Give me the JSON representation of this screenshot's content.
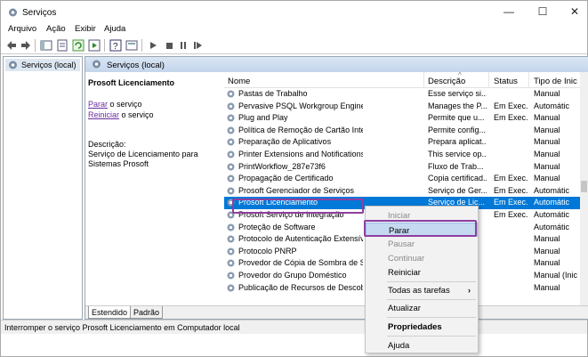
{
  "window": {
    "title": "Serviços",
    "minimize": "—",
    "maximize": "☐",
    "close": "✕"
  },
  "menu": [
    "Arquivo",
    "Ação",
    "Exibir",
    "Ajuda"
  ],
  "tree": {
    "root": "Serviços (local)"
  },
  "main": {
    "header": "Serviços (local)"
  },
  "detail": {
    "title": "Prosoft Licenciamento",
    "stop_link": "Parar",
    "stop_suffix": " o serviço",
    "restart_link": "Reiniciar",
    "restart_suffix": " o serviço",
    "desc_label": "Descrição:",
    "desc_line1": "Serviço de Licenciamento para",
    "desc_line2": "Sistemas Prosoft"
  },
  "columns": {
    "name": "Nome",
    "description": "Descrição",
    "status": "Status",
    "startup": "Tipo de Inic"
  },
  "services": [
    {
      "name": "Pastas de Trabalho",
      "desc": "Esse serviço si...",
      "status": "",
      "startup": "Manual"
    },
    {
      "name": "Pervasive PSQL Workgroup Engine",
      "desc": "Manages the P...",
      "status": "Em Exec...",
      "startup": "Automátic"
    },
    {
      "name": "Plug and Play",
      "desc": "Permite que u...",
      "status": "Em Exec...",
      "startup": "Manual"
    },
    {
      "name": "Política de Remoção de Cartão Inteligente",
      "desc": "Permite config...",
      "status": "",
      "startup": "Manual"
    },
    {
      "name": "Preparação de Aplicativos",
      "desc": "Prepara aplicat...",
      "status": "",
      "startup": "Manual"
    },
    {
      "name": "Printer Extensions and Notifications",
      "desc": "This service op...",
      "status": "",
      "startup": "Manual"
    },
    {
      "name": "PrintWorkflow_287e73f6",
      "desc": "Fluxo de Trab...",
      "status": "",
      "startup": "Manual"
    },
    {
      "name": "Propagação de Certificado",
      "desc": "Copia certificad...",
      "status": "Em Exec...",
      "startup": "Manual"
    },
    {
      "name": "Prosoft Gerenciador de Serviços",
      "desc": "Serviço de Ger...",
      "status": "Em Exec...",
      "startup": "Automátic"
    },
    {
      "name": "Prosoft Licenciamento",
      "desc": "Serviço de Lic...",
      "status": "Em Exec...",
      "startup": "Automátic"
    },
    {
      "name": "Prosoft Serviço de Integração",
      "desc": "",
      "status": "Em Exec...",
      "startup": "Automátic"
    },
    {
      "name": "Proteção de Software",
      "desc": "",
      "status": "",
      "startup": "Automátic"
    },
    {
      "name": "Protocolo de Autenticação Extensível",
      "desc": "",
      "status": "",
      "startup": "Manual"
    },
    {
      "name": "Protocolo PNRP",
      "desc": "",
      "status": "",
      "startup": "Manual"
    },
    {
      "name": "Provedor de Cópia de Sombra de Software",
      "desc": "",
      "status": "",
      "startup": "Manual"
    },
    {
      "name": "Provedor do Grupo Doméstico",
      "desc": "",
      "status": "",
      "startup": "Manual (Inic"
    },
    {
      "name": "Publicação de Recursos de Descoberta",
      "desc": "",
      "status": "",
      "startup": "Manual"
    }
  ],
  "context_menu": {
    "start": "Iniciar",
    "stop": "Parar",
    "pause": "Pausar",
    "resume": "Continuar",
    "restart": "Reiniciar",
    "all_tasks": "Todas as tarefas",
    "refresh": "Atualizar",
    "properties": "Propriedades",
    "help": "Ajuda"
  },
  "tabs": {
    "extended": "Estendido",
    "standard": "Padrão"
  },
  "status_bar": "Interromper o serviço Prosoft Licenciamento em Computador local",
  "colors": {
    "selection": "#0078d7",
    "highlight": "#8e3fa0",
    "menu_hover": "#c5d9f1",
    "link": "#6a2f9c"
  }
}
